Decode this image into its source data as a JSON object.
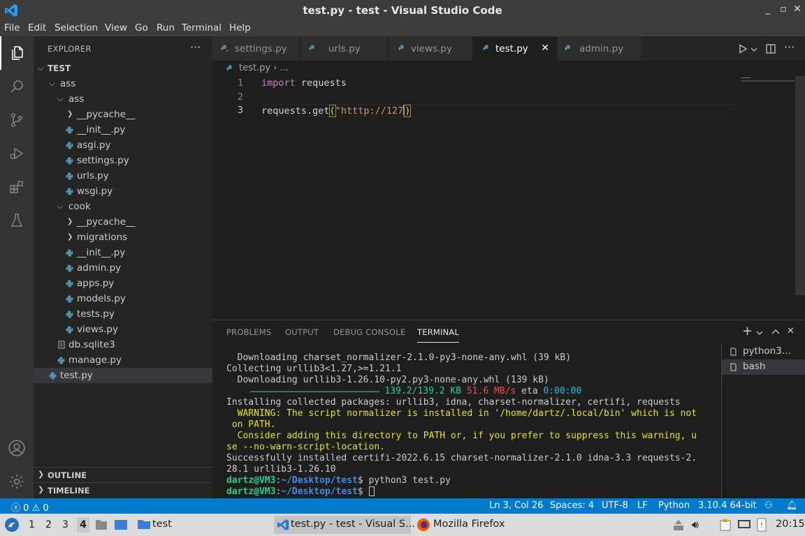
{
  "window": {
    "title": "test.py - test - Visual Studio Code",
    "min": "_",
    "max": "▫",
    "close": "✕"
  },
  "menu": [
    "File",
    "Edit",
    "Selection",
    "View",
    "Go",
    "Run",
    "Terminal",
    "Help"
  ],
  "explorer": {
    "header": "EXPLORER",
    "more": "···",
    "root": "TEST",
    "tree": [
      {
        "label": "ass",
        "kind": "folder-open",
        "depth": 1
      },
      {
        "label": "ass",
        "kind": "folder-open",
        "depth": 2
      },
      {
        "label": "__pycache__",
        "kind": "folder-closed",
        "depth": 3
      },
      {
        "label": "__init__.py",
        "kind": "py",
        "depth": 3
      },
      {
        "label": "asgi.py",
        "kind": "py",
        "depth": 3
      },
      {
        "label": "settings.py",
        "kind": "py",
        "depth": 3
      },
      {
        "label": "urls.py",
        "kind": "py",
        "depth": 3
      },
      {
        "label": "wsgi.py",
        "kind": "py",
        "depth": 3
      },
      {
        "label": "cook",
        "kind": "folder-open",
        "depth": 2
      },
      {
        "label": "__pycache__",
        "kind": "folder-closed",
        "depth": 3
      },
      {
        "label": "migrations",
        "kind": "folder-closed",
        "depth": 3
      },
      {
        "label": "__init__.py",
        "kind": "py",
        "depth": 3
      },
      {
        "label": "admin.py",
        "kind": "py",
        "depth": 3
      },
      {
        "label": "apps.py",
        "kind": "py",
        "depth": 3
      },
      {
        "label": "models.py",
        "kind": "py",
        "depth": 3
      },
      {
        "label": "tests.py",
        "kind": "py",
        "depth": 3
      },
      {
        "label": "views.py",
        "kind": "py",
        "depth": 3
      },
      {
        "label": "db.sqlite3",
        "kind": "db",
        "depth": 2
      },
      {
        "label": "manage.py",
        "kind": "py",
        "depth": 2
      },
      {
        "label": "test.py",
        "kind": "py",
        "depth": 1,
        "selected": true
      }
    ],
    "outline": "OUTLINE",
    "timeline": "TIMELINE"
  },
  "tabs": [
    {
      "label": "settings.py",
      "active": false
    },
    {
      "label": "urls.py",
      "active": false
    },
    {
      "label": "views.py",
      "active": false
    },
    {
      "label": "test.py",
      "active": true
    },
    {
      "label": "admin.py",
      "active": false
    }
  ],
  "tab_close": "✕",
  "breadcrumb": "test.py › ...",
  "editor": {
    "lines": [
      {
        "n": "1",
        "kw": "import",
        "rest": " requests"
      },
      {
        "n": "2"
      },
      {
        "n": "3",
        "pre": "requests.get",
        "open": "(",
        "str": "\"htttp://127",
        "close": ")"
      }
    ]
  },
  "panel": {
    "tabs": [
      "PROBLEMS",
      "OUTPUT",
      "DEBUG CONSOLE",
      "TERMINAL"
    ],
    "active_tab": "TERMINAL",
    "terminal": {
      "l1": "  Downloading charset_normalizer-2.1.0-py3-none-any.whl (39 kB)",
      "l2": "Collecting urllib3<1.27,>=1.21.1",
      "l3": "  Downloading urllib3-1.26.10-py2.py3-none-any.whl (139 kB)",
      "l4_bar": "━━━━━━━━━━━━━━━━━━━━━━━━━━━━━━━━━━━━━━━━",
      "l4_size": " 139.2/139.2 KB",
      "l4_speed": " 51.6 MB/s",
      "l4_eta": " eta ",
      "l4_time": "0:00:00",
      "l5": "Installing collected packages: urllib3, idna, charset-normalizer, certifi, requests",
      "l6": "  WARNING: The script normalizer is installed in '/home/dartz/.local/bin' which is not",
      "l7": " on PATH.",
      "l8": "  Consider adding this directory to PATH or, if you prefer to suppress this warning, u",
      "l9": "se --no-warn-script-location.",
      "l10": "Successfully installed certifi-2022.6.15 charset-normalizer-2.1.0 idna-3.3 requests-2.",
      "l11": "28.1 urllib3-1.26.10",
      "prompt_user": "dartz@VM3",
      "prompt_sep": ":",
      "prompt_path": "~/Desktop/test",
      "prompt_sign": "$ ",
      "cmd1": "python3 test.py"
    },
    "terminals": [
      {
        "label": "python3...",
        "selected": false
      },
      {
        "label": "bash",
        "selected": true
      }
    ]
  },
  "status": {
    "errors": "0",
    "warnings": "0",
    "position": "Ln 3, Col 26",
    "spaces": "Spaces: 4",
    "encoding": "UTF-8",
    "eol": "LF",
    "language": "Python",
    "interpreter": "3.10.4 64-bit"
  },
  "taskbar": {
    "workspaces": [
      "1",
      "2",
      "3",
      "4"
    ],
    "tasks": [
      "test",
      "test.py - test - Visual S...",
      "Mozilla Firefox"
    ],
    "clock": "20:15"
  },
  "colors": {
    "accent": "#007acc",
    "py_icon": "#519aba",
    "title_bg": "#3c3c3c"
  }
}
